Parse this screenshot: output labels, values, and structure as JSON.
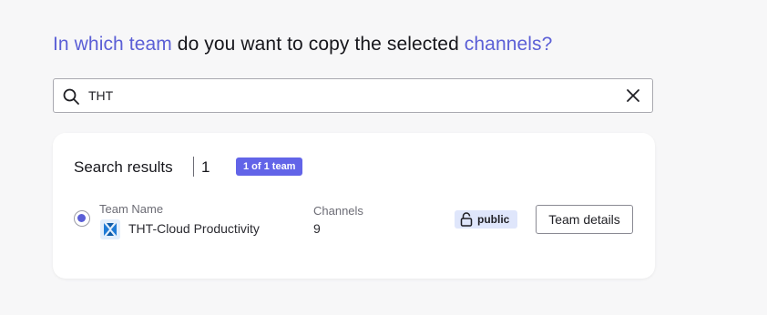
{
  "heading": {
    "part1": "In which team",
    "part2": " do you want to copy the selected ",
    "part3": "channels?"
  },
  "search": {
    "value": "THT",
    "placeholder": ""
  },
  "results": {
    "title": "Search results",
    "count": "1",
    "badge": "1 of 1 team",
    "row": {
      "team_label": "Team Name",
      "team_name": "THT-Cloud Productivity",
      "channels_label": "Channels",
      "channels_value": "9",
      "privacy": "public",
      "details_button": "Team details",
      "selected": true
    }
  },
  "colors": {
    "accent": "#5b5fd6",
    "badge": "#6264e8",
    "public_badge_bg": "#dfe6fb",
    "background": "#f7f7f8"
  },
  "icons": {
    "search": "search-icon",
    "clear": "close-icon",
    "team": "team-logo-icon",
    "privacy": "unlock-icon"
  }
}
